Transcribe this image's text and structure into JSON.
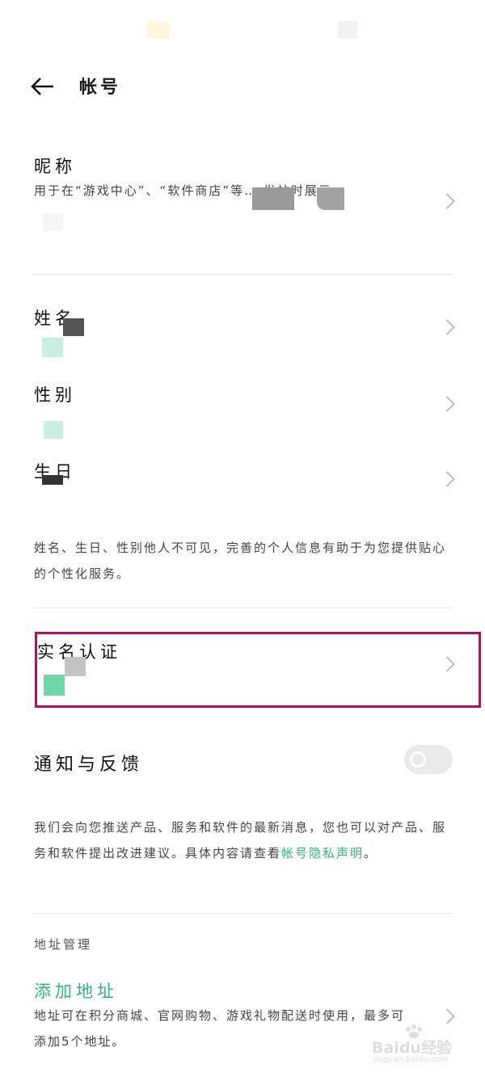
{
  "header": {
    "back_icon": "arrow-left-icon",
    "title": "帐号"
  },
  "nickname": {
    "label": "昵称",
    "desc": "用于在“游戏中心”、“软件商店”等… 发帖时展示"
  },
  "profile": {
    "name_label": "姓名",
    "gender_label": "性别",
    "birthday_label": "生日",
    "note": "姓名、生日、性别他人不可见，完善的个人信息有助于为您提供贴心的个性化服务。"
  },
  "verify": {
    "label": "实名认证"
  },
  "notify": {
    "label": "通知与反馈",
    "toggle_on": false,
    "desc": "我们会向您推送产品、服务和软件的最新消息，您也可以对产品、服务和软件提出改进建议。具体内容请查看",
    "link": "帐号隐私声明",
    "desc_end": "。"
  },
  "address": {
    "section": "地址管理",
    "add_label": "添加地址",
    "desc": "地址可在积分商城、官网购物、游戏礼物配送时使用，最多可添加5个地址。"
  },
  "watermark": {
    "brand": "Baidu经验",
    "url": "jingyan.baidu.com"
  },
  "colors": {
    "accent": "#2fb67a",
    "highlight_border": "#b0125d"
  }
}
